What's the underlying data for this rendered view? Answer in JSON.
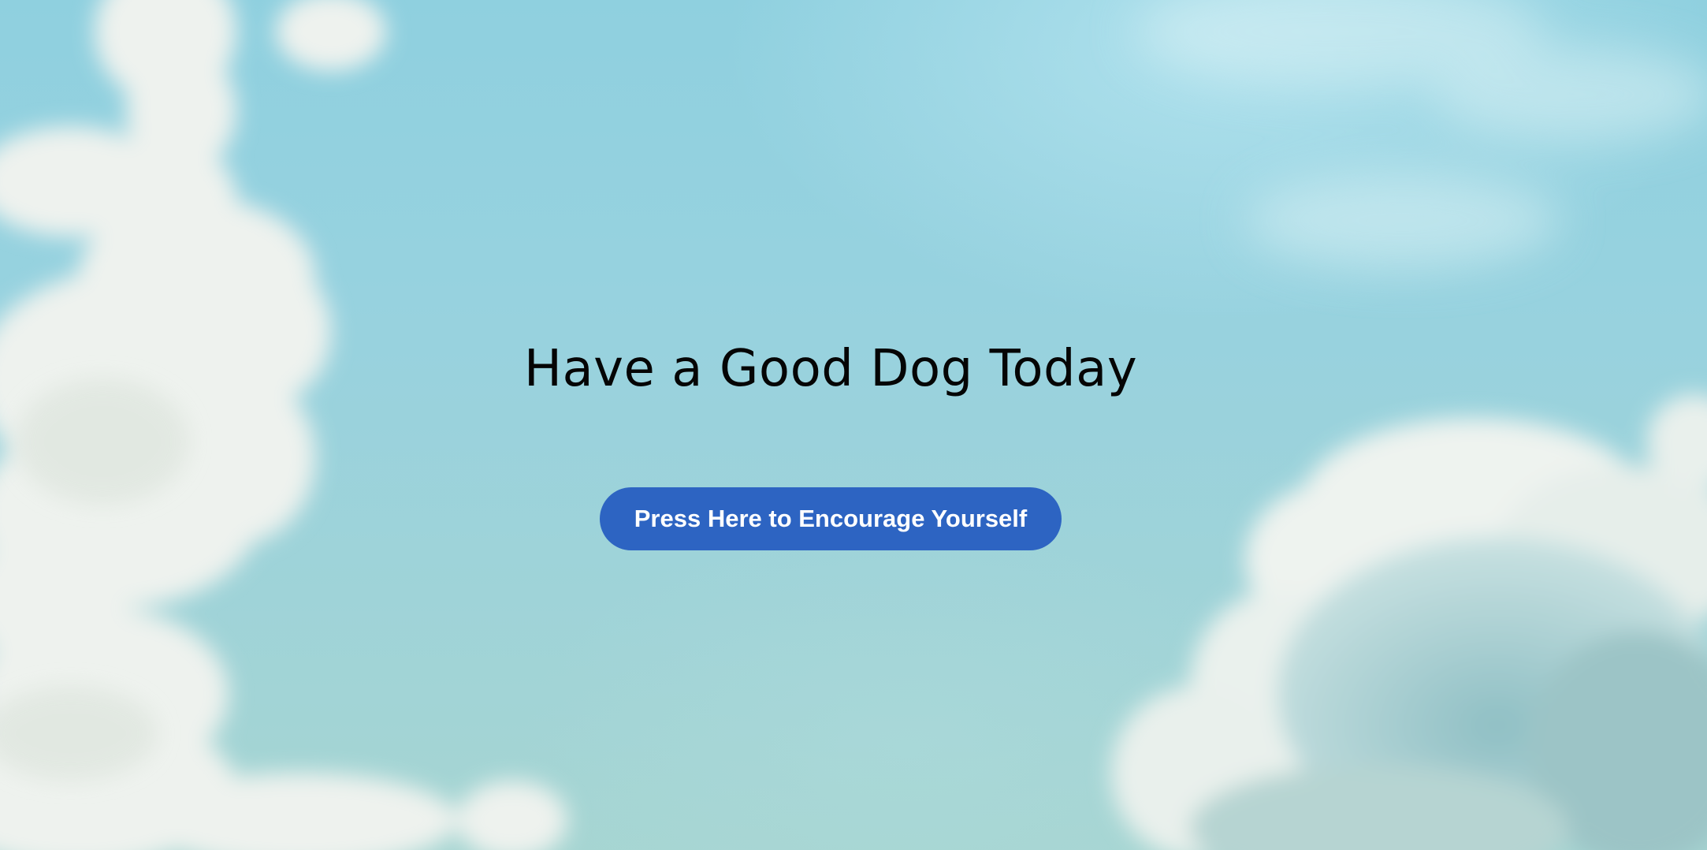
{
  "page": {
    "background": "sky-with-clouds-photo"
  },
  "hero": {
    "title": "Have a Good Dog Today",
    "button_label": "Press Here to Encourage Yourself"
  },
  "colors": {
    "sky": "#97d2df",
    "button_bg": "#2d64c2",
    "button_text": "#ffffff",
    "title_text": "#050505"
  }
}
